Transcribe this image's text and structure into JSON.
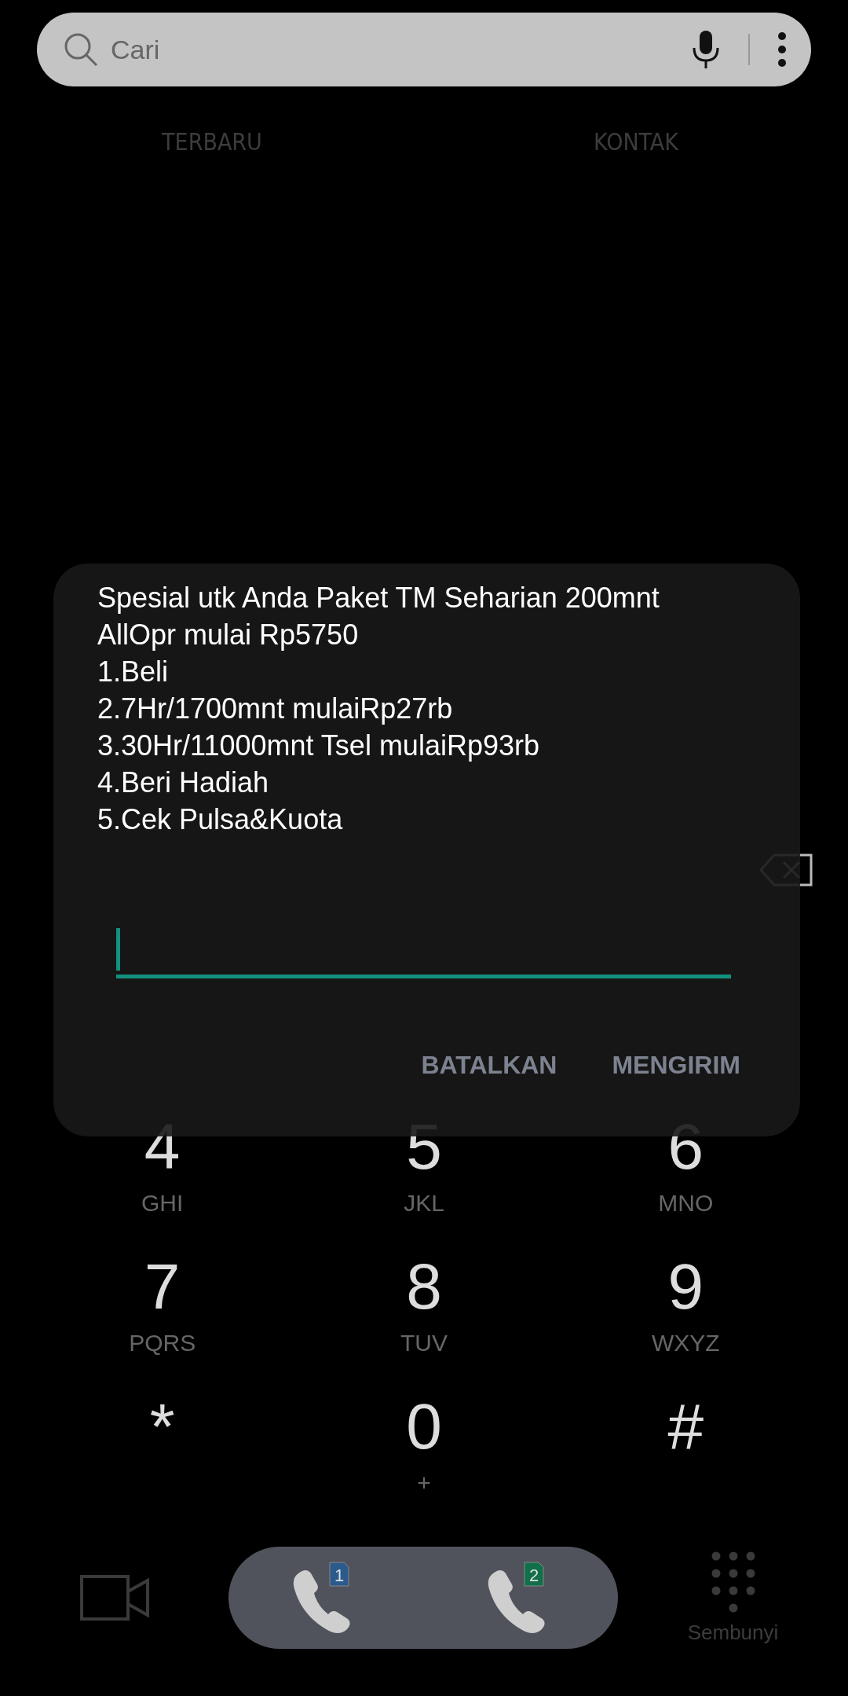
{
  "search": {
    "placeholder": "Cari"
  },
  "tabs": [
    {
      "label": "TERBARU",
      "selected": false
    },
    {
      "label": "KONTAK",
      "selected": false
    }
  ],
  "keypad": [
    {
      "digit": "4",
      "letters": "GHI"
    },
    {
      "digit": "5",
      "letters": "JKL"
    },
    {
      "digit": "6",
      "letters": "MNO"
    },
    {
      "digit": "7",
      "letters": "PQRS"
    },
    {
      "digit": "8",
      "letters": "TUV"
    },
    {
      "digit": "9",
      "letters": "WXYZ"
    },
    {
      "digit": "*"
    },
    {
      "digit": "0",
      "letters": "+"
    },
    {
      "digit": "#"
    }
  ],
  "call_buttons": [
    {
      "sim": "1",
      "color": "#2b5b8c"
    },
    {
      "sim": "2",
      "color": "#11704a"
    }
  ],
  "hide_label": "Sembunyi",
  "dialog": {
    "message_lines": [
      "Spesial utk Anda Paket TM Seharian 200mnt",
      "AllOpr mulai Rp5750",
      "1.Beli",
      "2.7Hr/1700mnt mulaiRp27rb",
      "3.30Hr/11000mnt Tsel mulaiRp93rb",
      "4.Beri Hadiah",
      "5.Cek Pulsa&Kuota"
    ],
    "reply_field": {
      "focused": true
    },
    "buttons": [
      "BATALKAN",
      "MENGIRIM"
    ]
  }
}
